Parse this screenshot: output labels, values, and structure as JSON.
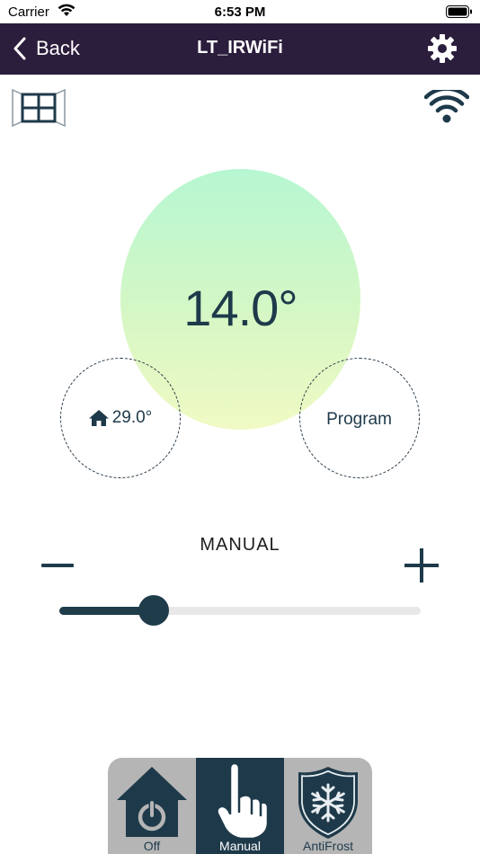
{
  "status": {
    "carrier": "Carrier",
    "time": "6:53 PM"
  },
  "nav": {
    "back_label": "Back",
    "title": "LT_IRWiFi"
  },
  "icons": {
    "window": "window-icon",
    "wifi": "wifi-signal-icon",
    "gear": "gear-icon",
    "home": "home-icon",
    "back": "chevron-left-icon"
  },
  "thermostat": {
    "setpoint": "14.0°",
    "home_temperature": "29.0°",
    "program_label": "Program",
    "mode_label": "MANUAL",
    "slider_fraction": 0.26
  },
  "modes": [
    {
      "label": "Off",
      "icon": "house-power-icon",
      "active": false
    },
    {
      "label": "Manual",
      "icon": "hand-pointer-icon",
      "active": true
    },
    {
      "label": "AntiFrost",
      "icon": "shield-snowflake-icon",
      "active": false
    }
  ],
  "colors": {
    "nav_bg": "#2b1d3c",
    "accent": "#1e3a4a",
    "circle_top": "#b6f7d2",
    "circle_bottom": "#f0fac4"
  }
}
